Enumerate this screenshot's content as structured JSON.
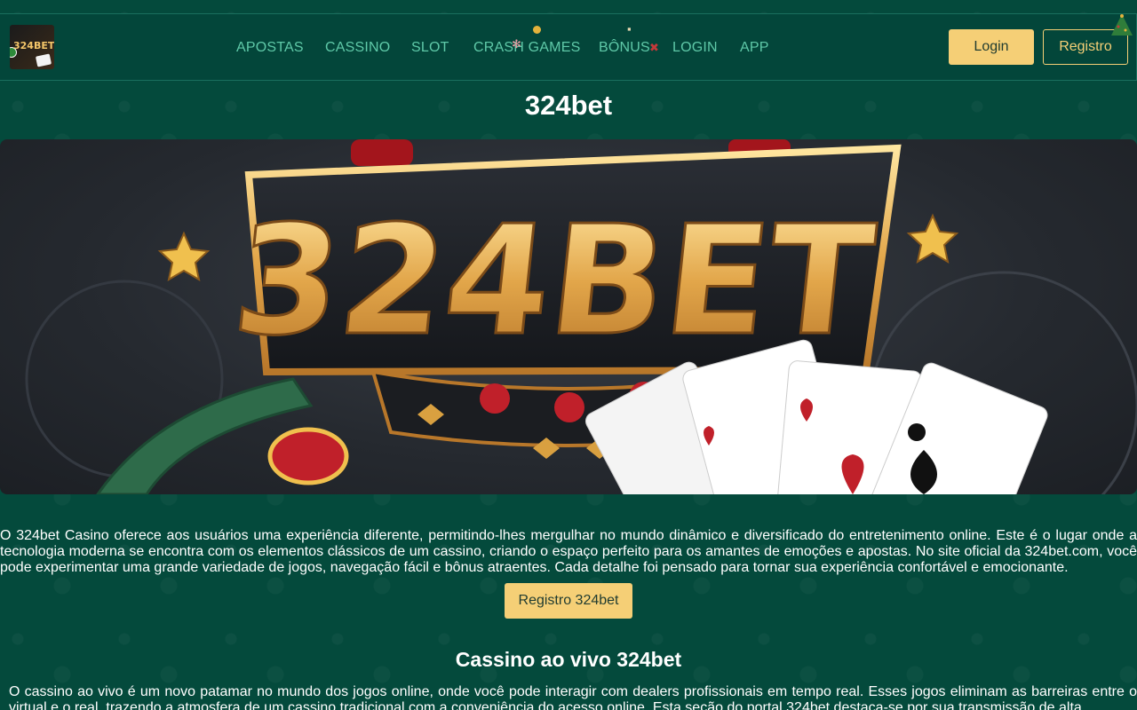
{
  "header": {
    "logo_text": "324BET",
    "nav": [
      {
        "label": "APOSTAS"
      },
      {
        "label": "CASSINO"
      },
      {
        "label": "SLOT"
      },
      {
        "label": "CRASH GAMES"
      },
      {
        "label": "BÔNUS"
      },
      {
        "label": "LOGIN"
      },
      {
        "label": "APP"
      }
    ],
    "login_label": "Login",
    "register_label": "Registro"
  },
  "page_title": "324bet",
  "banner": {
    "logo_text": "324BET"
  },
  "intro_text": "O 324bet Casino oferece aos usuários uma experiência diferente, permitindo-lhes mergulhar no mundo dinâmico e diversificado do entretenimento online. Este é o lugar onde a tecnologia moderna se encontra com os elementos clássicos de um cassino, criando o espaço perfeito para os amantes de emoções e apostas. No site oficial da 324bet.com, você pode experimentar uma grande variedade de jogos, navegação fácil e bônus atraentes. Cada detalhe foi pensado para tornar sua experiência confortável e emocionante.",
  "cta_label": "Registro 324bet",
  "live_section": {
    "heading": "Cassino ao vivo 324bet",
    "text": "O cassino ao vivo é um novo patamar no mundo dos jogos online, onde você pode interagir com dealers profissionais em tempo real. Esses jogos eliminam as barreiras entre o virtual e o real, trazendo a atmosfera de um cassino tradicional com a conveniência do acesso online. Esta seção do portal 324bet destaca-se por sua transmissão de alta"
  },
  "colors": {
    "background": "#044a3c",
    "nav_link": "#5fc9a8",
    "accent": "#f5cf76"
  }
}
